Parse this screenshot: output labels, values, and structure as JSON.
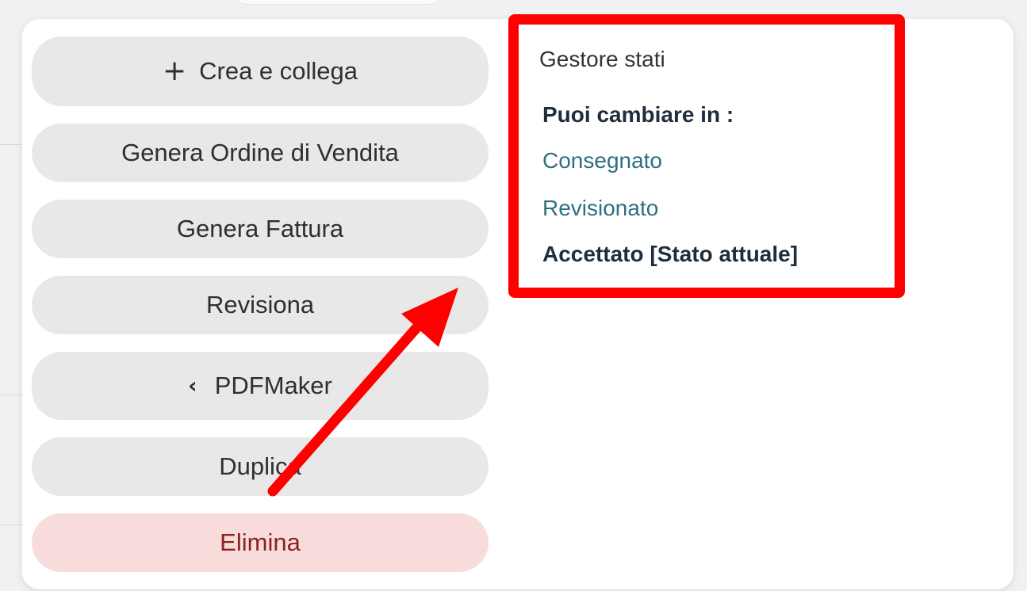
{
  "actions": {
    "create_link": {
      "label": "Crea e collega",
      "icon": "plus-icon"
    },
    "sales_order": {
      "label": "Genera Ordine di Vendita"
    },
    "invoice": {
      "label": "Genera Fattura"
    },
    "revise": {
      "label": "Revisiona"
    },
    "pdfmaker": {
      "label": "PDFMaker",
      "icon": "chevron-left-icon"
    },
    "duplicate": {
      "label": "Duplica"
    },
    "delete": {
      "label": "Elimina"
    }
  },
  "state_manager": {
    "title": "Gestore stati",
    "heading": "Puoi cambiare in :",
    "options": [
      "Consegnato",
      "Revisionato"
    ],
    "current": "Accettato [Stato attuale]"
  },
  "colors": {
    "highlight_box": "#ff0000",
    "arrow": "#ff0000",
    "link": "#2e6f82",
    "danger_bg": "#f8dcdc",
    "danger_text": "#8c2222",
    "button_bg": "#e8e8e9"
  }
}
